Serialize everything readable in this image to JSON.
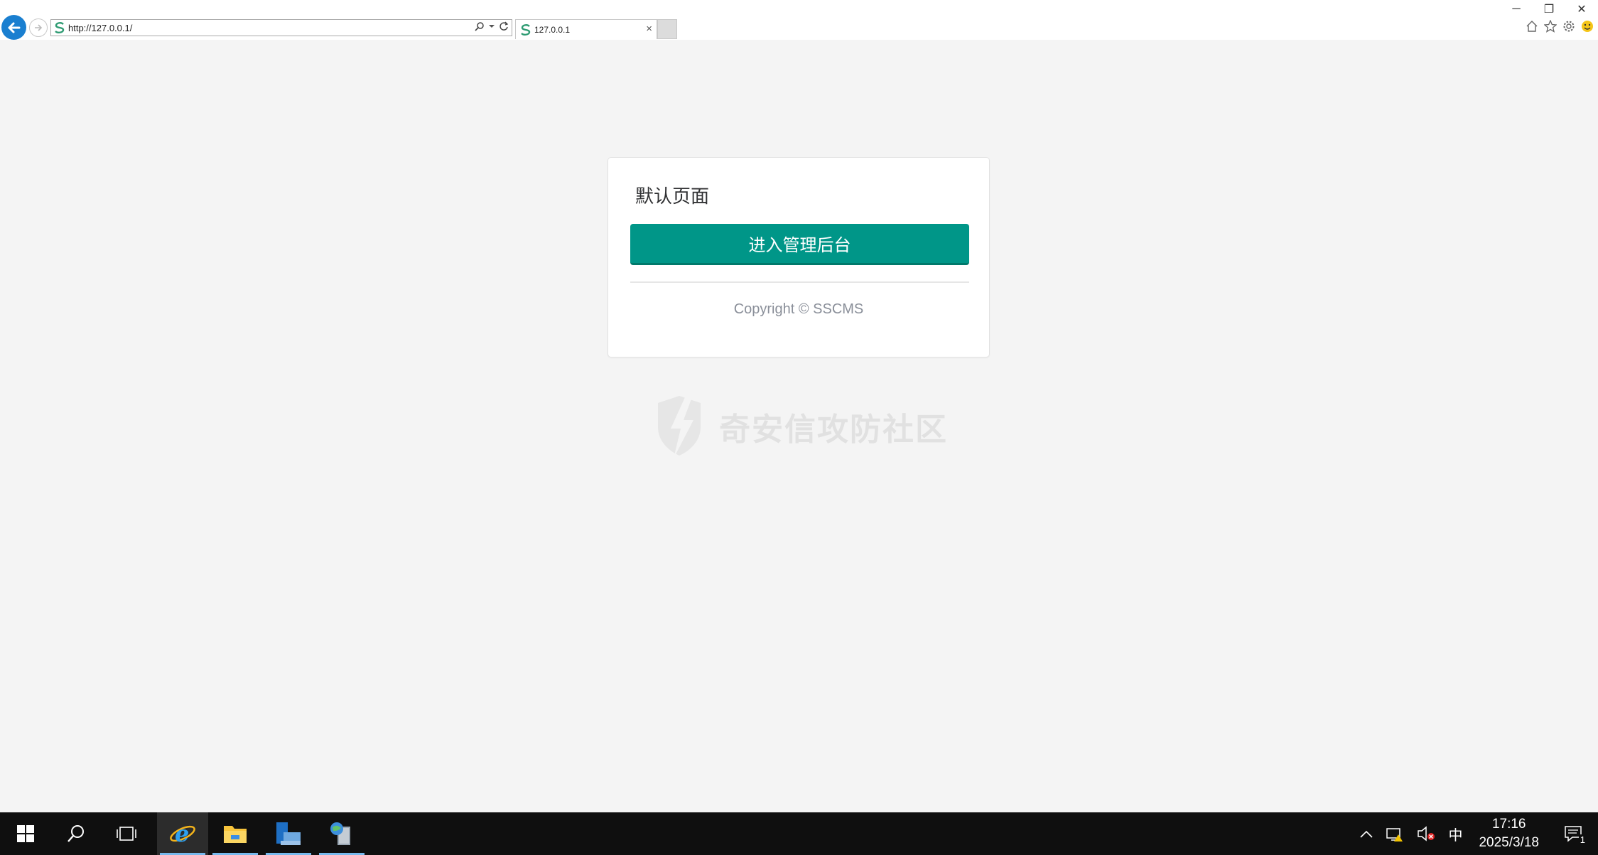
{
  "browser": {
    "url": "http://127.0.0.1/",
    "tab_title": "127.0.0.1",
    "tab_close": "×"
  },
  "window_controls": {
    "minimize": "─",
    "restore": "❐",
    "close": "✕"
  },
  "page": {
    "card_title": "默认页面",
    "enter_button": "进入管理后台",
    "copyright": "Copyright © SSCMS"
  },
  "watermark": {
    "text": "奇安信攻防社区"
  },
  "taskbar": {
    "ime": "中",
    "time": "17:16",
    "date": "2025/3/18",
    "notification_count": "1"
  },
  "colors": {
    "accent": "#009688",
    "ie_blue": "#1a7fd0",
    "page_bg": "#f4f4f4",
    "taskbar_bg": "#0f0f0f"
  },
  "icons": [
    "back-icon",
    "forward-icon",
    "site-icon",
    "search-icon",
    "dropdown-icon",
    "refresh-icon",
    "home-icon",
    "favorites-icon",
    "settings-icon",
    "smiley-icon",
    "windows-start-icon",
    "taskbar-search-icon",
    "task-view-icon",
    "ie-icon",
    "file-explorer-icon",
    "server-manager-icon",
    "network-icon",
    "volume-muted-icon",
    "chevron-up-icon",
    "action-center-icon"
  ]
}
